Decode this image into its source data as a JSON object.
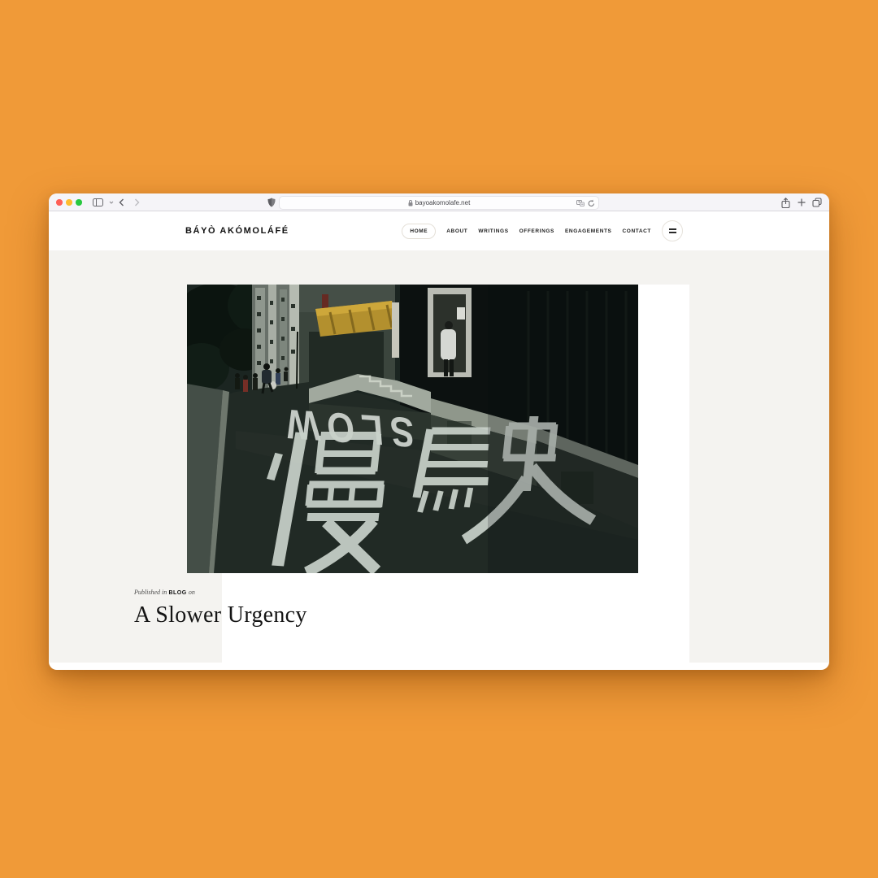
{
  "browser": {
    "url": "bayoakomolafe.net",
    "window_controls": [
      "close",
      "minimize",
      "zoom"
    ]
  },
  "site_header": {
    "logo": "BÁYÒ AKÓMOLÁFÉ",
    "nav": [
      {
        "label": "HOME",
        "active": true
      },
      {
        "label": "ABOUT",
        "active": false
      },
      {
        "label": "WRITINGS",
        "active": false
      },
      {
        "label": "OFFERINGS",
        "active": false
      },
      {
        "label": "ENGAGEMENTS",
        "active": false
      },
      {
        "label": "CONTACT",
        "active": false
      }
    ]
  },
  "article": {
    "published_prefix": "Published in",
    "category": "BLOG",
    "published_suffix": "on",
    "title": "A Slower Urgency"
  },
  "hero": {
    "painted_text_en": "SLOW",
    "painted_text_cjk": "慢駛"
  },
  "colors": {
    "background": "#F09A38",
    "page_background": "#F4F3F0",
    "traffic_red": "#FF5F57",
    "traffic_yellow": "#FEBC2E",
    "traffic_green": "#28C840"
  }
}
